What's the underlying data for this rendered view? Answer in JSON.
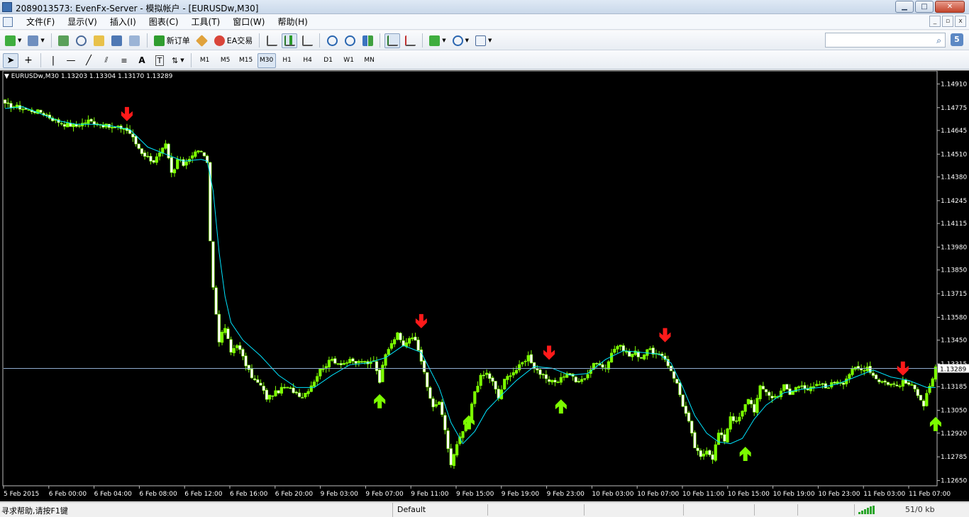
{
  "window": {
    "title": "2089013573: EvenFx-Server - 模拟帐户 - [EURUSDw,M30]",
    "minimize_glyph": "▁",
    "maximize_glyph": "□",
    "close_glyph": "✕"
  },
  "menu": {
    "items": [
      "文件(F)",
      "显示(V)",
      "插入(I)",
      "图表(C)",
      "工具(T)",
      "窗口(W)",
      "帮助(H)"
    ],
    "mdi_glyphs": [
      "_",
      "▫",
      "x"
    ]
  },
  "toolbar": {
    "new_order_label": "新订单",
    "ea_trading_label": "EA交易",
    "timeframes": [
      "M1",
      "M5",
      "M15",
      "M30",
      "H1",
      "H4",
      "D1",
      "W1",
      "MN"
    ],
    "active_timeframe": "M30",
    "search_placeholder": "",
    "chat_badge": "5"
  },
  "chart": {
    "header": "EURUSDw,M30  1.13203 1.13304 1.13170 1.13289",
    "current_price_label": "1.13289",
    "background_color": "#000000",
    "bull_color": "#7cfc00",
    "bear_body_color": "#ffffff",
    "ma_color": "#00e5ff",
    "sell_arrow_color": "#ff1a1a",
    "buy_arrow_color": "#7cfc00",
    "price_line_color": "#8faccf"
  },
  "chart_data": {
    "type": "candlestick",
    "symbol": "EURUSDw",
    "timeframe": "M30",
    "ohlc_last": {
      "open": 1.13203,
      "high": 1.13304,
      "low": 1.1317,
      "close": 1.13289
    },
    "y_ticks": [
      1.1491,
      1.14775,
      1.14645,
      1.1451,
      1.1438,
      1.14245,
      1.14115,
      1.1398,
      1.1385,
      1.13715,
      1.1358,
      1.1345,
      1.13315,
      1.13185,
      1.1305,
      1.1292,
      1.12785,
      1.1265
    ],
    "ylim": [
      1.1262,
      1.1496
    ],
    "x_ticks": [
      "5 Feb 2015",
      "6 Feb 00:00",
      "6 Feb 04:00",
      "6 Feb 08:00",
      "6 Feb 12:00",
      "6 Feb 16:00",
      "6 Feb 20:00",
      "9 Feb 03:00",
      "9 Feb 07:00",
      "9 Feb 11:00",
      "9 Feb 15:00",
      "9 Feb 19:00",
      "9 Feb 23:00",
      "10 Feb 03:00",
      "10 Feb 07:00",
      "10 Feb 11:00",
      "10 Feb 15:00",
      "10 Feb 19:00",
      "10 Feb 23:00",
      "11 Feb 03:00",
      "11 Feb 07:00"
    ],
    "current_price": 1.13289,
    "close_path": [
      [
        0,
        1.1479
      ],
      [
        4,
        1.1478
      ],
      [
        8,
        1.1476
      ],
      [
        12,
        1.1475
      ],
      [
        16,
        1.1471
      ],
      [
        20,
        1.1468
      ],
      [
        24,
        1.1467
      ],
      [
        28,
        1.147
      ],
      [
        32,
        1.1468
      ],
      [
        36,
        1.1466
      ],
      [
        40,
        1.1466
      ],
      [
        42,
        1.1463
      ],
      [
        44,
        1.1457
      ],
      [
        46,
        1.1452
      ],
      [
        48,
        1.1449
      ],
      [
        50,
        1.1447
      ],
      [
        52,
        1.1451
      ],
      [
        54,
        1.1456
      ],
      [
        56,
        1.144
      ],
      [
        57,
        1.1442
      ],
      [
        58,
        1.1448
      ],
      [
        60,
        1.1445
      ],
      [
        62,
        1.1449
      ],
      [
        64,
        1.1452
      ],
      [
        66,
        1.1453
      ],
      [
        68,
        1.1445
      ],
      [
        69,
        1.1402
      ],
      [
        70,
        1.1375
      ],
      [
        71,
        1.136
      ],
      [
        72,
        1.1345
      ],
      [
        74,
        1.1352
      ],
      [
        76,
        1.1338
      ],
      [
        78,
        1.1343
      ],
      [
        80,
        1.1335
      ],
      [
        82,
        1.1327
      ],
      [
        84,
        1.1322
      ],
      [
        86,
        1.1319
      ],
      [
        88,
        1.1312
      ],
      [
        90,
        1.1314
      ],
      [
        92,
        1.1316
      ],
      [
        94,
        1.1318
      ],
      [
        96,
        1.1317
      ],
      [
        98,
        1.1315
      ],
      [
        100,
        1.1313
      ],
      [
        102,
        1.1317
      ],
      [
        104,
        1.1322
      ],
      [
        106,
        1.1328
      ],
      [
        108,
        1.1331
      ],
      [
        110,
        1.1334
      ],
      [
        112,
        1.1332
      ],
      [
        114,
        1.1332
      ],
      [
        116,
        1.1333
      ],
      [
        118,
        1.1332
      ],
      [
        120,
        1.1333
      ],
      [
        122,
        1.1331
      ],
      [
        124,
        1.1334
      ],
      [
        126,
        1.1322
      ],
      [
        128,
        1.1338
      ],
      [
        130,
        1.1344
      ],
      [
        132,
        1.1348
      ],
      [
        134,
        1.1342
      ],
      [
        136,
        1.1346
      ],
      [
        138,
        1.1345
      ],
      [
        140,
        1.1334
      ],
      [
        142,
        1.1318
      ],
      [
        144,
        1.1306
      ],
      [
        146,
        1.131
      ],
      [
        148,
        1.1293
      ],
      [
        150,
        1.1274
      ],
      [
        152,
        1.1285
      ],
      [
        154,
        1.1293
      ],
      [
        156,
        1.13
      ],
      [
        158,
        1.1316
      ],
      [
        160,
        1.1324
      ],
      [
        162,
        1.1326
      ],
      [
        164,
        1.1321
      ],
      [
        166,
        1.1312
      ],
      [
        168,
        1.1322
      ],
      [
        170,
        1.1326
      ],
      [
        172,
        1.1328
      ],
      [
        174,
        1.1332
      ],
      [
        176,
        1.1336
      ],
      [
        178,
        1.133
      ],
      [
        180,
        1.1326
      ],
      [
        182,
        1.1322
      ],
      [
        184,
        1.1321
      ],
      [
        186,
        1.1322
      ],
      [
        188,
        1.1325
      ],
      [
        190,
        1.1326
      ],
      [
        192,
        1.1321
      ],
      [
        194,
        1.1322
      ],
      [
        196,
        1.1326
      ],
      [
        198,
        1.1331
      ],
      [
        200,
        1.1332
      ],
      [
        202,
        1.1329
      ],
      [
        204,
        1.1338
      ],
      [
        206,
        1.1342
      ],
      [
        208,
        1.134
      ],
      [
        210,
        1.1336
      ],
      [
        212,
        1.1338
      ],
      [
        214,
        1.1335
      ],
      [
        216,
        1.134
      ],
      [
        218,
        1.1338
      ],
      [
        220,
        1.1336
      ],
      [
        222,
        1.1334
      ],
      [
        224,
        1.1328
      ],
      [
        226,
        1.132
      ],
      [
        228,
        1.1308
      ],
      [
        230,
        1.1298
      ],
      [
        232,
        1.1284
      ],
      [
        234,
        1.1278
      ],
      [
        236,
        1.1283
      ],
      [
        238,
        1.1278
      ],
      [
        240,
        1.1292
      ],
      [
        242,
        1.1288
      ],
      [
        244,
        1.1302
      ],
      [
        246,
        1.1298
      ],
      [
        248,
        1.1304
      ],
      [
        250,
        1.1312
      ],
      [
        252,
        1.1305
      ],
      [
        254,
        1.1318
      ],
      [
        256,
        1.1316
      ],
      [
        258,
        1.1312
      ],
      [
        260,
        1.1314
      ],
      [
        262,
        1.1319
      ],
      [
        264,
        1.1314
      ],
      [
        266,
        1.1318
      ],
      [
        268,
        1.132
      ],
      [
        270,
        1.1317
      ],
      [
        272,
        1.1318
      ],
      [
        274,
        1.132
      ],
      [
        276,
        1.1318
      ],
      [
        278,
        1.132
      ],
      [
        280,
        1.1322
      ],
      [
        282,
        1.1321
      ],
      [
        284,
        1.1326
      ],
      [
        286,
        1.1329
      ],
      [
        288,
        1.1328
      ],
      [
        290,
        1.133
      ],
      [
        292,
        1.1325
      ],
      [
        294,
        1.1322
      ],
      [
        296,
        1.1321
      ],
      [
        298,
        1.132
      ],
      [
        300,
        1.1319
      ],
      [
        302,
        1.1321
      ],
      [
        304,
        1.132
      ],
      [
        306,
        1.1317
      ],
      [
        308,
        1.1312
      ],
      [
        309,
        1.1308
      ],
      [
        310,
        1.1315
      ],
      [
        312,
        1.1322
      ],
      [
        313,
        1.1329
      ]
    ],
    "ma_path": [
      [
        0,
        1.1477
      ],
      [
        6,
        1.1478
      ],
      [
        12,
        1.1474
      ],
      [
        18,
        1.147
      ],
      [
        24,
        1.1468
      ],
      [
        30,
        1.1468
      ],
      [
        36,
        1.1467
      ],
      [
        42,
        1.1465
      ],
      [
        48,
        1.1455
      ],
      [
        54,
        1.1451
      ],
      [
        60,
        1.1447
      ],
      [
        66,
        1.1448
      ],
      [
        68,
        1.1447
      ],
      [
        70,
        1.143
      ],
      [
        72,
        1.1395
      ],
      [
        74,
        1.137
      ],
      [
        76,
        1.1355
      ],
      [
        80,
        1.1345
      ],
      [
        86,
        1.1336
      ],
      [
        92,
        1.1325
      ],
      [
        98,
        1.1318
      ],
      [
        104,
        1.1318
      ],
      [
        110,
        1.1325
      ],
      [
        116,
        1.1331
      ],
      [
        122,
        1.1332
      ],
      [
        128,
        1.1335
      ],
      [
        134,
        1.1342
      ],
      [
        140,
        1.1338
      ],
      [
        146,
        1.1318
      ],
      [
        150,
        1.1298
      ],
      [
        154,
        1.1286
      ],
      [
        158,
        1.1293
      ],
      [
        162,
        1.1305
      ],
      [
        166,
        1.1312
      ],
      [
        172,
        1.1322
      ],
      [
        178,
        1.133
      ],
      [
        184,
        1.1329
      ],
      [
        190,
        1.1325
      ],
      [
        196,
        1.1326
      ],
      [
        202,
        1.1334
      ],
      [
        208,
        1.1339
      ],
      [
        214,
        1.1338
      ],
      [
        220,
        1.1337
      ],
      [
        224,
        1.1332
      ],
      [
        228,
        1.1318
      ],
      [
        232,
        1.1302
      ],
      [
        236,
        1.1292
      ],
      [
        240,
        1.1287
      ],
      [
        244,
        1.1286
      ],
      [
        248,
        1.1289
      ],
      [
        252,
        1.13
      ],
      [
        256,
        1.1308
      ],
      [
        262,
        1.1315
      ],
      [
        268,
        1.1317
      ],
      [
        274,
        1.1318
      ],
      [
        280,
        1.132
      ],
      [
        286,
        1.1324
      ],
      [
        292,
        1.1328
      ],
      [
        298,
        1.1324
      ],
      [
        304,
        1.1322
      ],
      [
        310,
        1.1318
      ],
      [
        313,
        1.1318
      ]
    ],
    "sell_signals": [
      [
        41,
        1.1473
      ],
      [
        140,
        1.1355
      ],
      [
        183,
        1.1337
      ],
      [
        222,
        1.1347
      ],
      [
        302,
        1.1328
      ]
    ],
    "buy_signals": [
      [
        126,
        1.1311
      ],
      [
        156,
        1.1299
      ],
      [
        187,
        1.1308
      ],
      [
        249,
        1.1281
      ],
      [
        313,
        1.1298
      ]
    ]
  },
  "status": {
    "help_text": "寻求帮助,请按F1键",
    "profile": "Default",
    "traffic": "51/0 kb"
  }
}
